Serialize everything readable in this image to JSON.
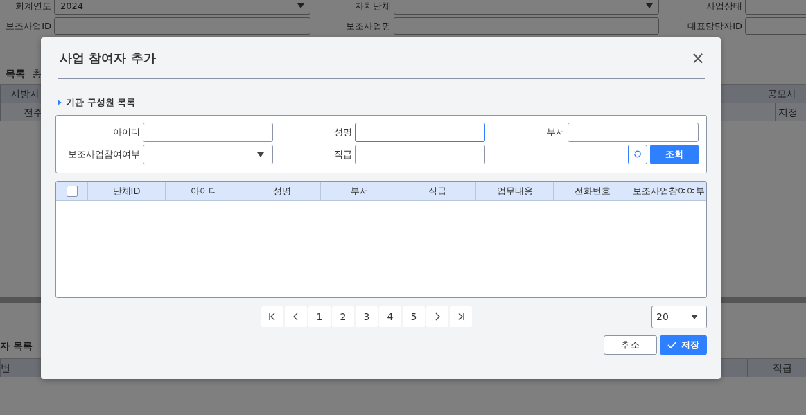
{
  "background": {
    "filter_rows": [
      [
        {
          "label": "회계연도",
          "kind": "select",
          "value": "2024"
        },
        {
          "label": "자치단체",
          "kind": "select"
        },
        {
          "label": "사업상태",
          "kind": "text"
        }
      ],
      [
        {
          "label": "보조사업ID",
          "kind": "text"
        },
        {
          "label": "보조사업명",
          "kind": "text"
        },
        {
          "label": "대표담당자ID",
          "kind": "text"
        }
      ]
    ],
    "list_title": "목록",
    "list_count": "총",
    "table": {
      "left_header": "지방자",
      "right_header": "공모사",
      "left_cell": "전주",
      "right_cell": "지정"
    },
    "participants_title": "자 목록",
    "participants_table": {
      "left_header": "번",
      "right_header": "직급"
    }
  },
  "dialog": {
    "title": "사업 참여자 추가",
    "close": "×",
    "section_title": "기관 구성원 목록",
    "search_fields": [
      {
        "label": "아이디",
        "kind": "text",
        "focused": false
      },
      {
        "label": "성명",
        "kind": "text",
        "focused": true
      },
      {
        "label": "부서",
        "kind": "text",
        "focused": false
      },
      {
        "label": "보조사업참여여부",
        "kind": "select",
        "focused": false
      },
      {
        "label": "직급",
        "kind": "text",
        "focused": false
      }
    ],
    "search_button": "조회",
    "table": {
      "select_all_checked": false,
      "columns": [
        "단체ID",
        "아이디",
        "성명",
        "부서",
        "직급",
        "업무내용",
        "전화번호",
        "보조사업참여여부"
      ]
    },
    "pagination": {
      "pages": [
        "1",
        "2",
        "3",
        "4",
        "5"
      ]
    },
    "page_size": "20",
    "buttons": [
      {
        "label": "취소",
        "kind": "secondary"
      },
      {
        "label": "저장",
        "kind": "primary"
      }
    ]
  }
}
